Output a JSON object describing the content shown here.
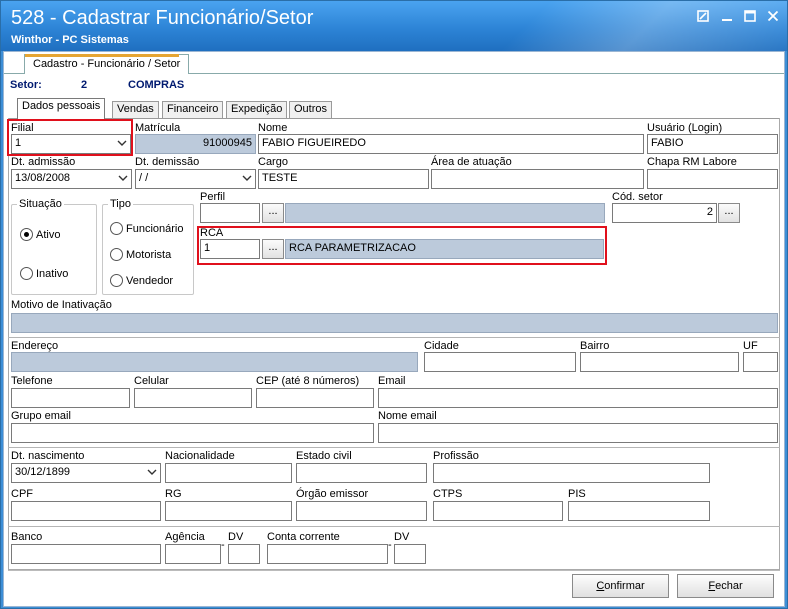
{
  "window": {
    "title": "528 - Cadastrar Funcionário/Setor",
    "subtitle": "Winthor - PC Sistemas"
  },
  "top_tab": "Cadastro - Funcionário / Setor",
  "setor": {
    "label": "Setor:",
    "code": "2",
    "name": "COMPRAS"
  },
  "tabs": [
    "Dados pessoais",
    "Vendas",
    "Financeiro",
    "Expedição",
    "Outros"
  ],
  "fields": {
    "filial_label": "Filial",
    "filial_value": "1",
    "matricula_label": "Matrícula",
    "matricula_value": "91000945",
    "nome_label": "Nome",
    "nome_value": "FABIO FIGUEIREDO",
    "usuario_label": "Usuário (Login)",
    "usuario_value": "FABIO",
    "dt_admissao_label": "Dt. admissão",
    "dt_admissao_value": "13/08/2008",
    "dt_demissao_label": "Dt.  demissão",
    "dt_demissao_value": " /  /",
    "cargo_label": "Cargo",
    "cargo_value": "TESTE",
    "area_label": "Área de atuação",
    "area_value": "",
    "chapa_label": "Chapa RM Labore",
    "chapa_value": "",
    "perfil_label": "Perfil",
    "perfil_code": "",
    "perfil_desc": "",
    "cod_setor_label": "Cód. setor",
    "cod_setor_value": "2",
    "rca_label": "RCA",
    "rca_code": "1",
    "rca_desc": "RCA PARAMETRIZACAO",
    "motivo_label": "Motivo de Inativação",
    "motivo_value": "",
    "endereco_label": "Endereço",
    "endereco_value": "",
    "cidade_label": "Cidade",
    "bairro_label": "Bairro",
    "uf_label": "UF",
    "telefone_label": "Telefone",
    "celular_label": "Celular",
    "cep_label": "CEP (até 8 números)",
    "email_label": "Email",
    "grupo_email_label": "Grupo email",
    "nome_email_label": "Nome email",
    "dt_nascimento_label": "Dt. nascimento",
    "dt_nascimento_value": "30/12/1899",
    "nacionalidade_label": "Nacionalidade",
    "estado_civil_label": "Estado civil",
    "profissao_label": "Profissão",
    "cpf_label": "CPF",
    "rg_label": "RG",
    "orgao_label": "Órgão emissor",
    "ctps_label": "CTPS",
    "pis_label": "PIS",
    "banco_label": "Banco",
    "agencia_label": "Agência",
    "dv_label": "DV",
    "conta_label": "Conta corrente",
    "dv2_label": "DV"
  },
  "situacao": {
    "label": "Situação",
    "ativo": "Ativo",
    "inativo": "Inativo",
    "selected": "Ativo"
  },
  "tipo": {
    "label": "Tipo",
    "funcionario": "Funcionário",
    "motorista": "Motorista",
    "vendedor": "Vendedor"
  },
  "buttons": {
    "confirmar_first": "C",
    "confirmar_rest": "onfirmar",
    "fechar_first": "F",
    "fechar_rest": "echar",
    "ellipsis": "..."
  },
  "colors": {
    "titlebar": "#2d84d6",
    "highlight_border": "#e0101c",
    "readonly_fill": "#bccadb",
    "setor_text": "#001a70"
  }
}
